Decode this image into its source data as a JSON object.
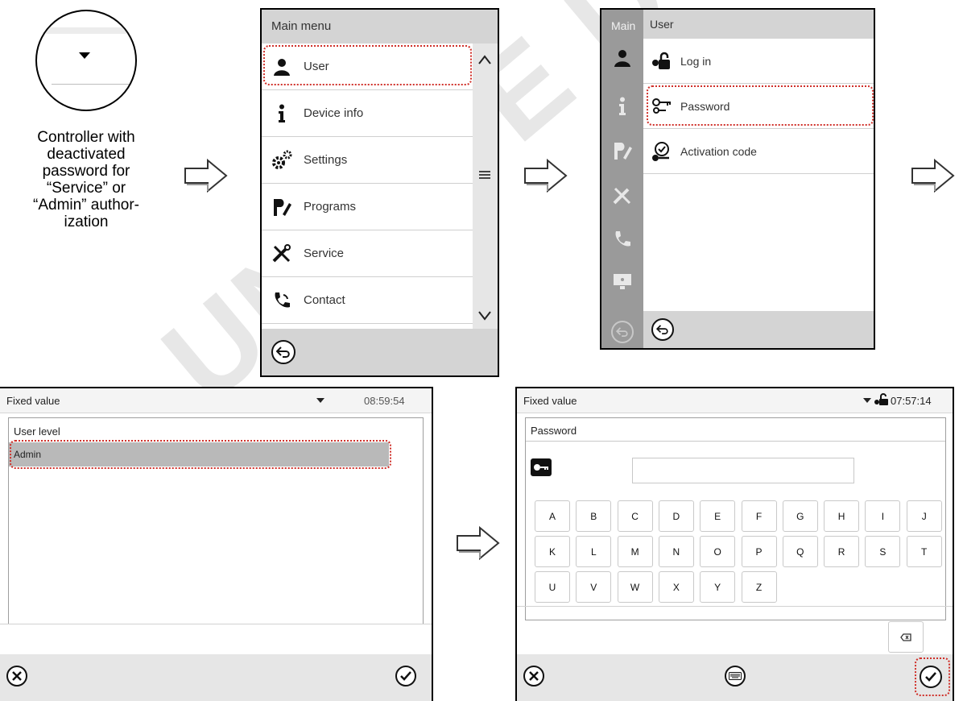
{
  "controller": {
    "caption_lines": [
      "Controller with",
      "deactivated",
      "password for",
      "“Service” or",
      "“Admin” author-",
      "ization"
    ]
  },
  "main_menu": {
    "title": "Main menu",
    "items": [
      {
        "label": "User",
        "icon": "user-icon"
      },
      {
        "label": "Device info",
        "icon": "info-icon"
      },
      {
        "label": "Settings",
        "icon": "gears-icon"
      },
      {
        "label": "Programs",
        "icon": "programs-icon"
      },
      {
        "label": "Service",
        "icon": "tools-icon"
      },
      {
        "label": "Contact",
        "icon": "phone-icon"
      }
    ]
  },
  "user_menu": {
    "tab_main": "Main",
    "tab_user": "User",
    "items": [
      {
        "label": "Log in",
        "icon": "lock-icon"
      },
      {
        "label": "Password",
        "icon": "keys-icon"
      },
      {
        "label": "Activation code",
        "icon": "activation-icon"
      }
    ]
  },
  "fixed_value_left": {
    "title": "Fixed value",
    "time": "08:59:54",
    "section": "User level",
    "selected_option": "Admin"
  },
  "fixed_value_right": {
    "title": "Fixed value",
    "time": "07:57:14",
    "section": "Password",
    "password_value": "",
    "keys_row1": [
      "A",
      "B",
      "C",
      "D",
      "E",
      "F",
      "G",
      "H",
      "I",
      "J"
    ],
    "keys_row2": [
      "K",
      "L",
      "M",
      "N",
      "O",
      "P",
      "Q",
      "R",
      "S",
      "T"
    ],
    "keys_row3": [
      "U",
      "V",
      "W",
      "X",
      "Y",
      "Z"
    ]
  },
  "colors": {
    "highlight": "#d0302a",
    "header_gray": "#d4d4d4",
    "selected_row": "#b9b9b9"
  },
  "watermark": "UNIQUE DUTSCHER"
}
